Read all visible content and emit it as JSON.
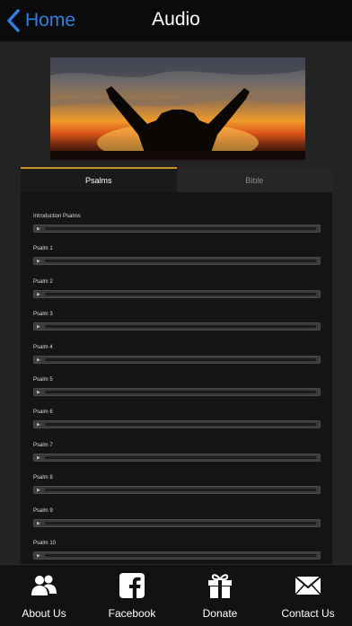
{
  "nav": {
    "back_label": "Home",
    "title": "Audio"
  },
  "hero": {
    "description": "Silhouette of a person raising arms against a sunset sky"
  },
  "tabs": [
    {
      "label": "Psalms",
      "active": true
    },
    {
      "label": "Bible",
      "active": false
    }
  ],
  "tracks": [
    {
      "label": "Introduction Psalms",
      "progress": 0.0
    },
    {
      "label": "Psalm 1",
      "progress": 0.0
    },
    {
      "label": "Psalm 2",
      "progress": 0.0
    },
    {
      "label": "Psalm 3",
      "progress": 0.0
    },
    {
      "label": "Psalm 4",
      "progress": 0.0
    },
    {
      "label": "Psalm 5",
      "progress": 0.0
    },
    {
      "label": "Psalm 6",
      "progress": 0.0
    },
    {
      "label": "Psalm 7",
      "progress": 0.0
    },
    {
      "label": "Psalm 8",
      "progress": 0.0
    },
    {
      "label": "Psalm 9",
      "progress": 0.0
    },
    {
      "label": "Psalm 10",
      "progress": 0.0
    }
  ],
  "tabbar": [
    {
      "label": "About Us",
      "icon": "people-icon"
    },
    {
      "label": "Facebook",
      "icon": "facebook-icon"
    },
    {
      "label": "Donate",
      "icon": "gift-icon"
    },
    {
      "label": "Contact Us",
      "icon": "envelope-icon"
    }
  ],
  "colors": {
    "accent": "#c8932c",
    "link": "#2f7fe0"
  }
}
